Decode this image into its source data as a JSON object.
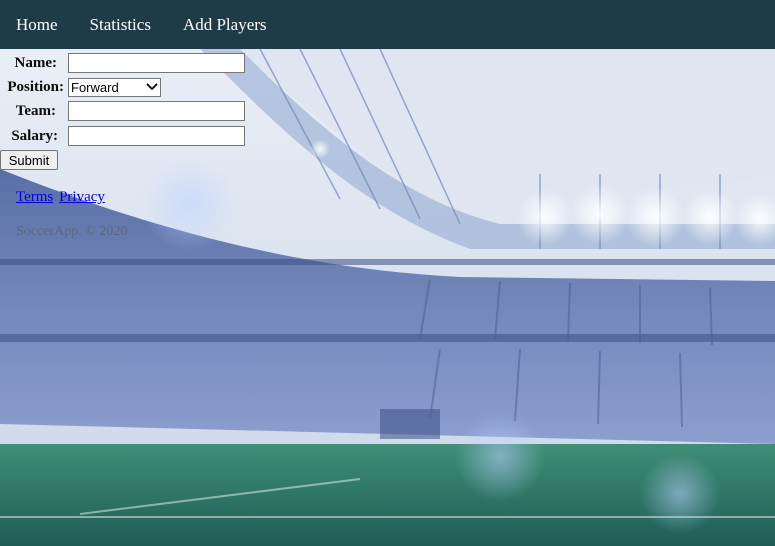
{
  "nav": {
    "items": [
      {
        "label": "Home"
      },
      {
        "label": "Statistics"
      },
      {
        "label": "Add Players"
      }
    ]
  },
  "form": {
    "name_label": "Name:",
    "name_value": "",
    "position_label": "Position:",
    "position_value": "Forward",
    "team_label": "Team:",
    "team_value": "",
    "salary_label": "Salary:",
    "salary_value": "",
    "submit_label": "Submit"
  },
  "footer": {
    "terms_label": "Terms",
    "privacy_label": "Privacy",
    "copyright": "SoccerApp. © 2020"
  },
  "colors": {
    "navbar": "#1f3b48",
    "link": "#0000ee"
  }
}
